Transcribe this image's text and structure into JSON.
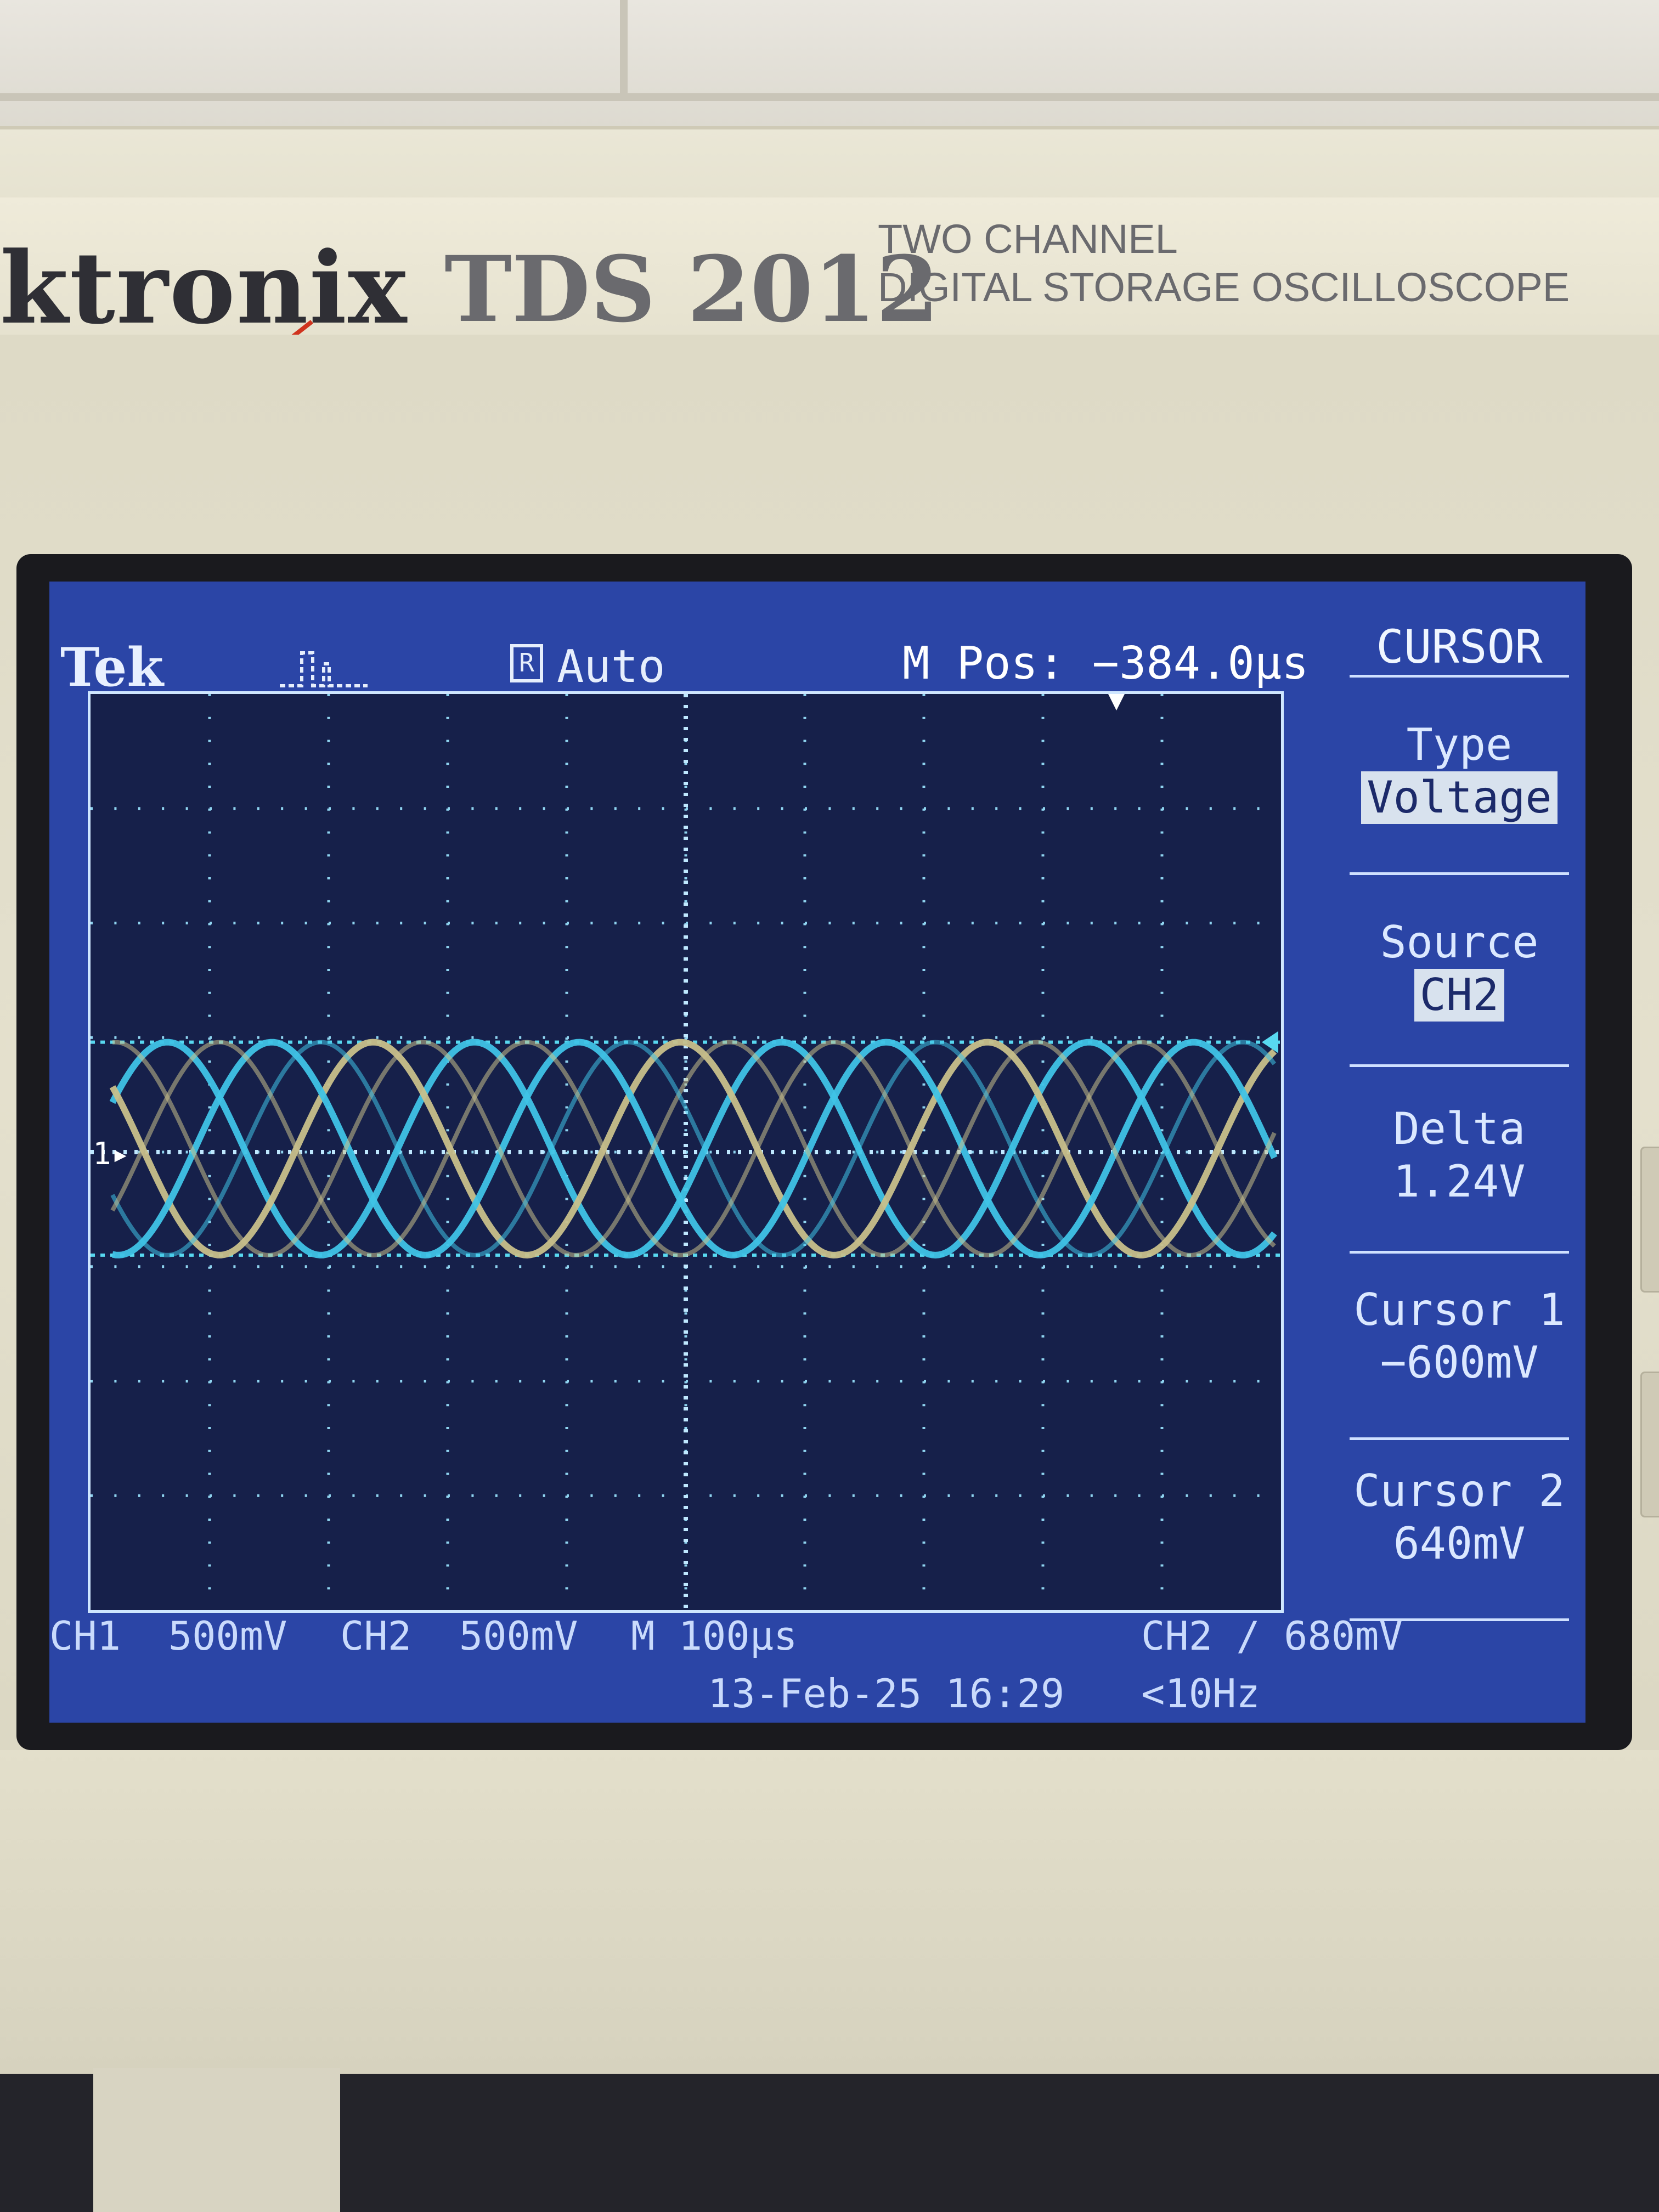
{
  "brand": {
    "logo_text": "ktronix",
    "model": "TDS 2012",
    "description_line1": "TWO CHANNEL",
    "description_line2": "DIGITAL STORAGE OSCILLOSCOPE"
  },
  "screen": {
    "header": {
      "logo": "Tek",
      "acq_mode": "Auto",
      "trigger_icon": "R",
      "horizontal_position": "M Pos: −384.0µs"
    },
    "menu": {
      "title": "CURSOR",
      "items": [
        {
          "label": "Type",
          "value": "Voltage",
          "boxed": true
        },
        {
          "label": "Source",
          "value": "CH2",
          "boxed": true
        },
        {
          "label": "Delta",
          "value": "1.24V",
          "boxed": false
        },
        {
          "label": "Cursor 1",
          "value": "−600mV",
          "boxed": false
        },
        {
          "label": "Cursor 2",
          "value": "640mV",
          "boxed": false
        }
      ]
    },
    "footer": {
      "ch1": "CH1  500mV",
      "ch2": "CH2  500mV",
      "timebase": "M 100µs",
      "trigger": "CH2 ∕ 680mV",
      "date": "13-Feb-25 16:29",
      "freq": "<10Hz"
    },
    "ch1_marker": "1",
    "colors": {
      "screen_bg": "#2b45a6",
      "trace_ch2": "#3fc3e6",
      "trace_ch1": "#c8c08a",
      "cursor": "#58d8f0"
    }
  }
}
